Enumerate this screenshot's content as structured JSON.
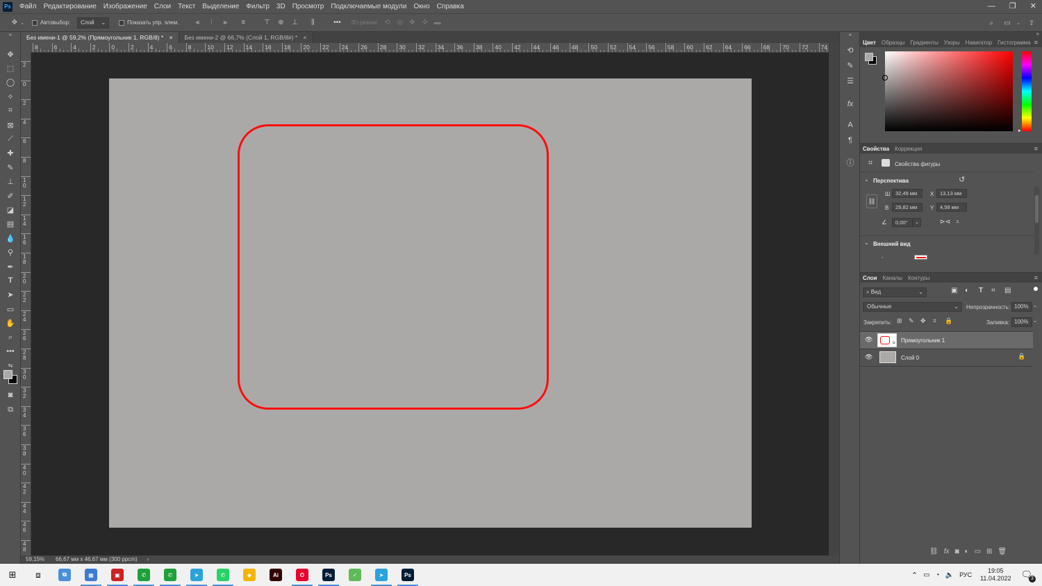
{
  "menu": {
    "app_icon": "Ps",
    "items": [
      "Файл",
      "Редактирование",
      "Изображение",
      "Слои",
      "Текст",
      "Выделение",
      "Фильтр",
      "3D",
      "Просмотр",
      "Подключаемые модули",
      "Окно",
      "Справка"
    ],
    "window_controls": [
      "—",
      "❐",
      "✕"
    ]
  },
  "options": {
    "autoselect_label": "Автовыбор:",
    "autoselect_value": "Слой",
    "show_controls_label": "Показать упр. элем.",
    "mode_3d_label": "3D-режим:",
    "more_label": "•••"
  },
  "tabs": [
    {
      "label": "Без имени-1 @ 59,2% (Прямоугольник 1, RGB/8) *",
      "close": "×"
    },
    {
      "label": "Без имени-2 @ 66,7% (Слой 1, RGB/8#) *",
      "close": "×"
    }
  ],
  "ruler": {
    "top_labels": [
      "8",
      "6",
      "4",
      "2",
      "0",
      "2",
      "4",
      "6",
      "8",
      "10",
      "12",
      "14",
      "16",
      "18",
      "20",
      "22",
      "24",
      "26",
      "28",
      "30",
      "32",
      "34",
      "36",
      "38",
      "40",
      "42",
      "44",
      "46",
      "48",
      "50",
      "52",
      "54",
      "56",
      "58",
      "60",
      "62",
      "64",
      "66",
      "68",
      "70",
      "72",
      "74"
    ],
    "left_labels": [
      "2",
      "0",
      "2",
      "4",
      "6",
      "8",
      "10",
      "12",
      "14",
      "16",
      "18",
      "20",
      "22",
      "24",
      "26",
      "28",
      "30",
      "32",
      "34",
      "36",
      "38",
      "40",
      "42",
      "44",
      "46",
      "48"
    ]
  },
  "status": {
    "zoom": "59,15%",
    "doc_info": "66,67 мм x 46,67 мм (300 ppcm)",
    "arrow": "›"
  },
  "color_panel": {
    "tabs": [
      "Цвет",
      "Образцы",
      "Градиенты",
      "Узоры",
      "Навигатор",
      "Гистограмма"
    ],
    "hue_color": "#ff0000"
  },
  "properties_panel": {
    "tabs": [
      "Свойства",
      "Коррекция"
    ],
    "header": "Свойства фигуры",
    "section_transform": "Перспектива",
    "w_label": "Ш",
    "w_value": "32,49 мм",
    "x_label": "X",
    "x_value": "13,13 мм",
    "h_label": "В",
    "h_value": "29,82 мм",
    "y_label": "Y",
    "y_value": "4,58 мм",
    "angle_value": "0,00°",
    "section_appearance": "Внешний вид",
    "fill_dash": "-"
  },
  "layers_panel": {
    "tabs": [
      "Слои",
      "Каналы",
      "Контуры"
    ],
    "filter_label": "Вид",
    "blend_mode": "Обычные",
    "opacity_label": "Непрозрачность:",
    "opacity_value": "100%",
    "lock_label": "Закрепить:",
    "fill_label": "Заливка:",
    "fill_value": "100%",
    "layers": [
      {
        "name": "Прямоугольник 1",
        "selected": true
      },
      {
        "name": "Слой 0",
        "locked": true
      }
    ]
  },
  "taskbar": {
    "apps": [
      {
        "label": "⧉",
        "color": "#4a8fd8"
      },
      {
        "label": "▦",
        "color": "#3d7bd1"
      },
      {
        "label": "▣",
        "color": "#cc2222"
      },
      {
        "label": "✆",
        "color": "#1fa03a"
      },
      {
        "label": "✆",
        "color": "#1fa03a"
      },
      {
        "label": "➤",
        "color": "#2aa3db"
      },
      {
        "label": "✆",
        "color": "#25d366"
      },
      {
        "label": "◆",
        "color": "#f5b400"
      },
      {
        "label": "Ai",
        "color": "#330000"
      },
      {
        "label": "O",
        "color": "#e8002d"
      },
      {
        "label": "Ps",
        "color": "#001e36"
      },
      {
        "label": "✓",
        "color": "#5fba58"
      },
      {
        "label": "➤",
        "color": "#2aa3db"
      },
      {
        "label": "Ps",
        "color": "#001e36"
      }
    ],
    "lang": "РУС",
    "time": "19:05",
    "date": "11.04.2022",
    "notif_count": "3"
  }
}
